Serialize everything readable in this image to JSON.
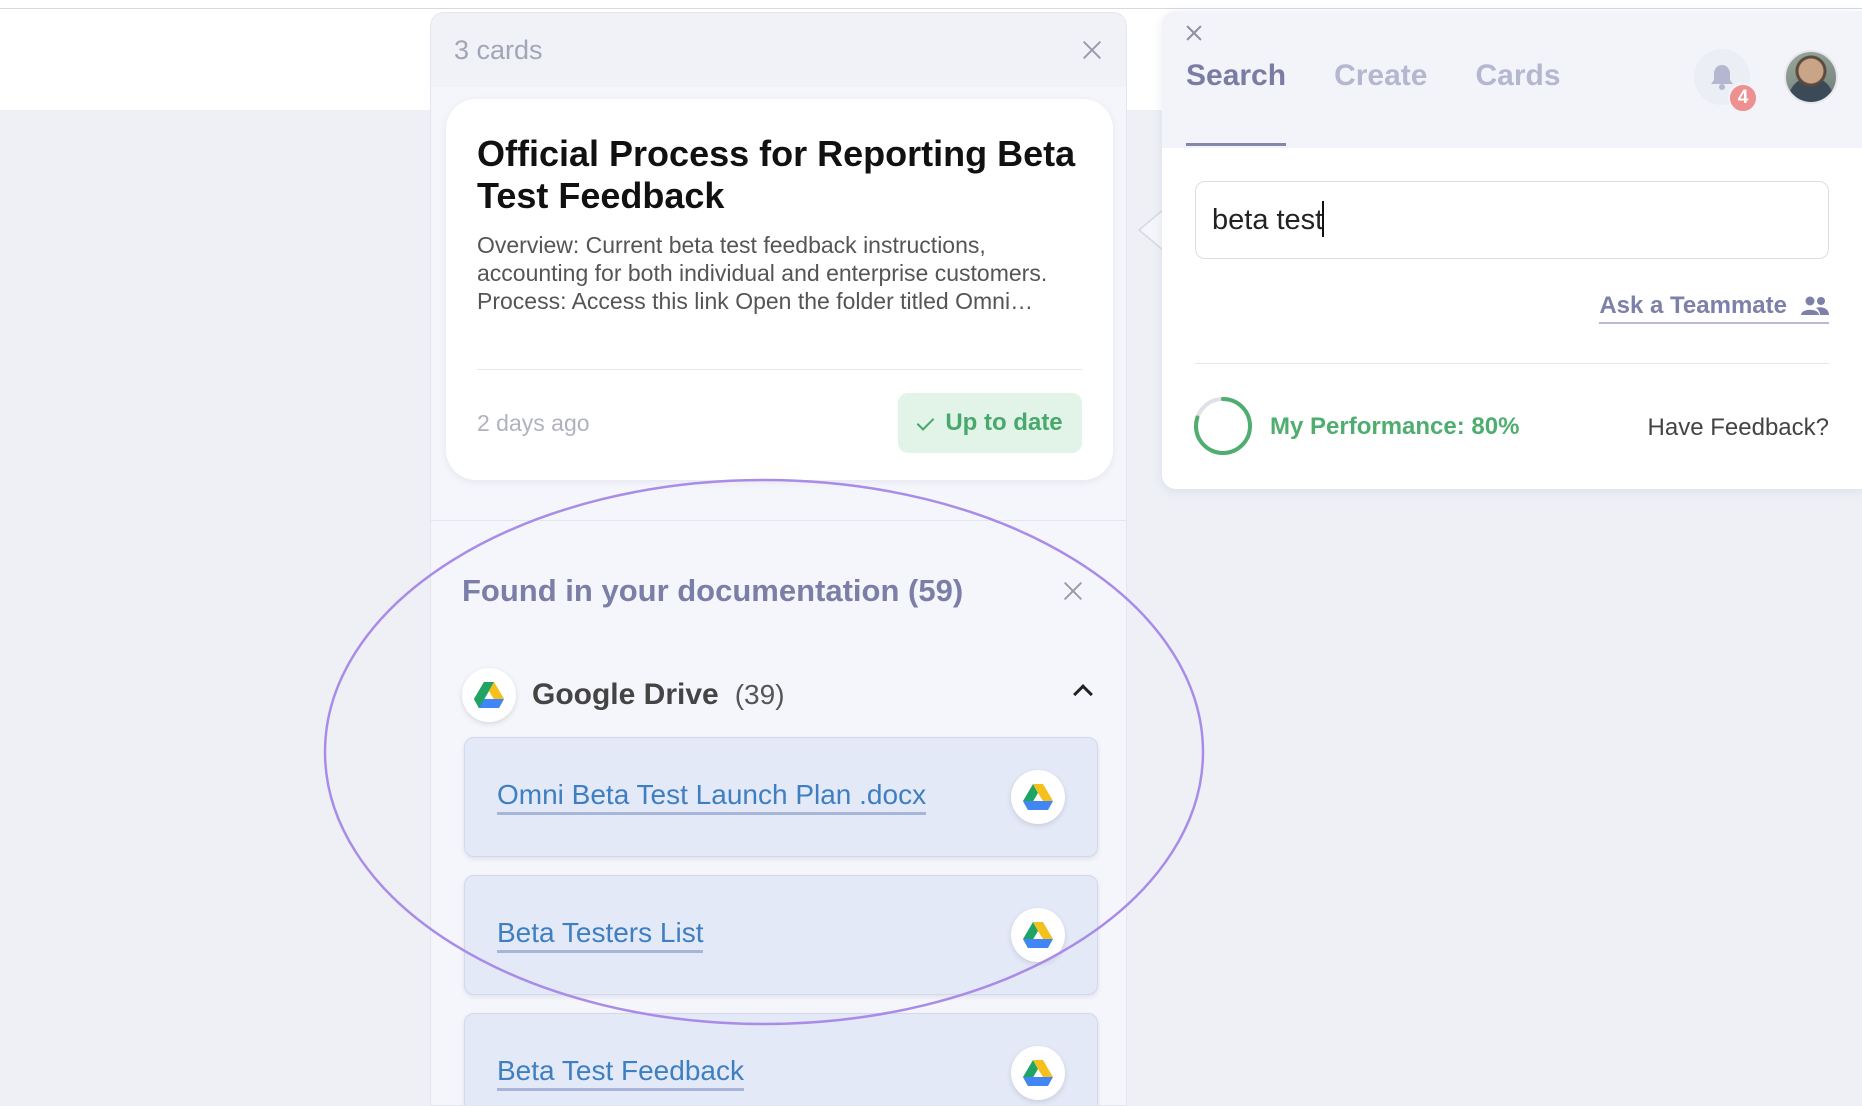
{
  "cards_panel": {
    "count_label": "3 cards",
    "card": {
      "title": "Official Process for Reporting Beta Test Feedback",
      "body": "Overview: Current beta test feedback instructions, accounting for both individual and enterprise customers. Process: Access this link Open the folder titled Omni…",
      "date": "2 days ago",
      "status": "Up to date"
    },
    "found": {
      "title": "Found in your documentation (59)",
      "source": {
        "name": "Google Drive",
        "count": "(39)",
        "icon": "google-drive-icon"
      },
      "documents": [
        {
          "label": "Omni Beta Test Launch Plan .docx",
          "icon": "google-drive-icon"
        },
        {
          "label": "Beta Testers List",
          "icon": "google-drive-icon"
        },
        {
          "label": "Beta Test Feedback",
          "icon": "google-drive-icon"
        }
      ]
    }
  },
  "search_panel": {
    "tabs": [
      "Search",
      "Create",
      "Cards"
    ],
    "active_tab": "Search",
    "notifications_count": "4",
    "search_value": "beta test",
    "ask_teammate": "Ask a Teammate",
    "performance": {
      "label": "My Performance: 80%",
      "value": 0.8
    },
    "feedback_link": "Have Feedback?"
  },
  "colors": {
    "accent": "#7a7ca3",
    "success": "#49a86c",
    "link": "#3e7fc2",
    "annotation": "#a98be8",
    "badge": "#ee8f90"
  }
}
